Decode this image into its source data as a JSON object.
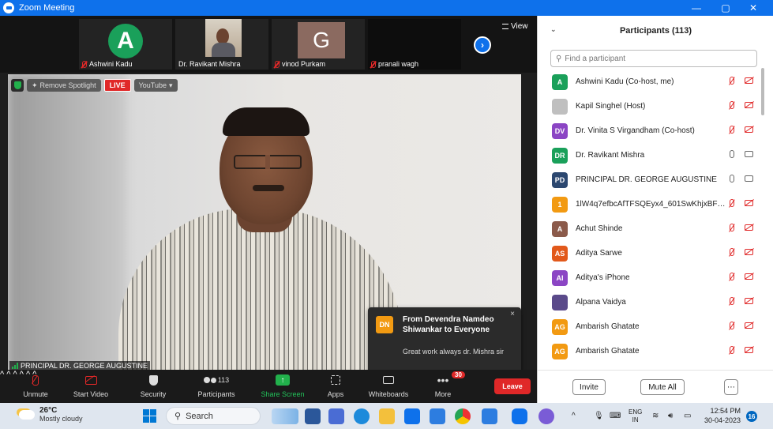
{
  "window": {
    "title": "Zoom Meeting",
    "minimize": "—",
    "maximize": "▢",
    "close": "✕"
  },
  "strip": {
    "thumbs": [
      {
        "name": "Ashwini Kadu",
        "initial": "A"
      },
      {
        "name": "Dr. Ravikant Mishra"
      },
      {
        "name": "vinod Purkam",
        "initial": "G"
      },
      {
        "name": "pranali wagh"
      }
    ],
    "view_label": "View",
    "next_arrow": "›"
  },
  "video": {
    "remove_spotlight": "Remove Spotlight",
    "live": "LIVE",
    "youtube": "YouTube",
    "speaker_name": "PRINCIPAL DR. GEORGE AUGUSTINE"
  },
  "chat_popup": {
    "initials": "DN",
    "from": "From Devendra Namdeo Shiwankar to Everyone",
    "message": "Great work always dr. Mishra sir",
    "close": "×"
  },
  "toolbar": {
    "unmute": "Unmute",
    "start_video": "Start Video",
    "security": "Security",
    "participants": "Participants",
    "participants_count": "113",
    "share_screen": "Share Screen",
    "apps": "Apps",
    "whiteboards": "Whiteboards",
    "more": "More",
    "more_badge": "30",
    "leave": "Leave",
    "caret": "^"
  },
  "panel": {
    "title": "Participants (113)",
    "search_placeholder": "Find a participant",
    "invite": "Invite",
    "mute_all": "Mute All",
    "more": "⋯",
    "participants": [
      {
        "initials": "A",
        "name": "Ashwini Kadu (Co-host, me)",
        "color": "#1aa05a",
        "mic": "off",
        "cam": "off"
      },
      {
        "initials": "",
        "name": "Kapil Singhel (Host)",
        "color": "#bfbfbf",
        "mic": "off",
        "cam": "off"
      },
      {
        "initials": "DV",
        "name": "Dr. Vinita  S Virgandham (Co-host)",
        "color": "#8b45c4",
        "mic": "off",
        "cam": "off"
      },
      {
        "initials": "DR",
        "name": "Dr. Ravikant Mishra",
        "color": "#1aa05a",
        "mic": "on",
        "cam": "on"
      },
      {
        "initials": "PD",
        "name": "PRINCIPAL DR. GEORGE AUGUSTINE",
        "color": "#2c4870",
        "mic": "on",
        "cam": "on"
      },
      {
        "initials": "1",
        "name": "1lW4q7efbcAfTFSQEyx4_601SwKhjxBFBb...",
        "color": "#f29a12",
        "mic": "off",
        "cam": "off"
      },
      {
        "initials": "A",
        "name": "Achut Shinde",
        "color": "#8b5a4a",
        "mic": "off",
        "cam": "off"
      },
      {
        "initials": "AS",
        "name": "Aditya Sarwe",
        "color": "#e2591b",
        "mic": "off",
        "cam": "off"
      },
      {
        "initials": "AI",
        "name": "Aditya's iPhone",
        "color": "#8b45c4",
        "mic": "off",
        "cam": "off"
      },
      {
        "initials": "",
        "name": "Alpana Vaidya",
        "color": "#5a4a8a",
        "mic": "off",
        "cam": "off"
      },
      {
        "initials": "AG",
        "name": "Ambarish Ghatate",
        "color": "#f29a12",
        "mic": "off",
        "cam": "off"
      },
      {
        "initials": "AG",
        "name": "Ambarish Ghatate",
        "color": "#f29a12",
        "mic": "off",
        "cam": "off"
      }
    ]
  },
  "taskbar": {
    "temp": "26°C",
    "weather": "Mostly cloudy",
    "search": "Search",
    "lang1": "ENG",
    "lang2": "IN",
    "time": "12:54 PM",
    "date": "30-04-2023",
    "notif_count": "16",
    "chevron": "^"
  }
}
